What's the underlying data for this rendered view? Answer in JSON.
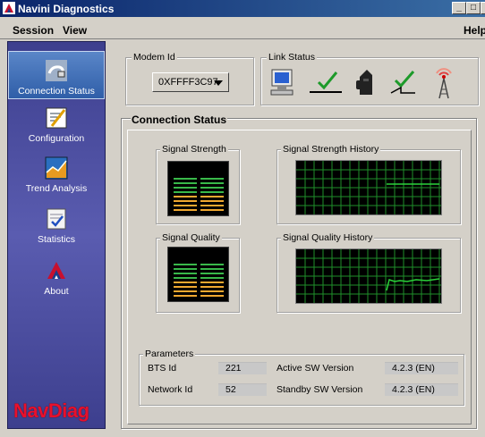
{
  "window": {
    "title": "Navini Diagnostics"
  },
  "menu": {
    "session": "Session",
    "view": "View",
    "help": "Help"
  },
  "sidebar": {
    "items": [
      {
        "label": "Connection Status",
        "icon": "connection-icon"
      },
      {
        "label": "Configuration",
        "icon": "configuration-icon"
      },
      {
        "label": "Trend Analysis",
        "icon": "trend-icon"
      },
      {
        "label": "Statistics",
        "icon": "statistics-icon"
      },
      {
        "label": "About",
        "icon": "about-icon"
      }
    ],
    "logo": "NavDiag"
  },
  "modem": {
    "label": "Modem Id",
    "value": "0XFFFF3C97"
  },
  "link_status": {
    "label": "Link Status",
    "icons": [
      "computer-icon",
      "checkmark-icon",
      "modem-device-icon",
      "checkmark-icon",
      "tower-icon"
    ]
  },
  "connection": {
    "title": "Connection Status",
    "signal_strength": "Signal Strength",
    "signal_strength_history": "Signal Strength History",
    "signal_quality": "Signal Quality",
    "signal_quality_history": "Signal Quality History"
  },
  "parameters": {
    "title": "Parameters",
    "bts_id_label": "BTS Id",
    "bts_id": "221",
    "network_id_label": "Network Id",
    "network_id": "52",
    "active_sw_label": "Active SW Version",
    "active_sw": "4.2.3 (EN)",
    "standby_sw_label": "Standby SW Version",
    "standby_sw": "4.2.3 (EN)"
  },
  "colors": {
    "meter_green": "#39b94a",
    "meter_orange": "#f0a830",
    "grid_green": "#1f8f2a",
    "trace": "#2bd33a",
    "logo_red": "#e8102c"
  }
}
